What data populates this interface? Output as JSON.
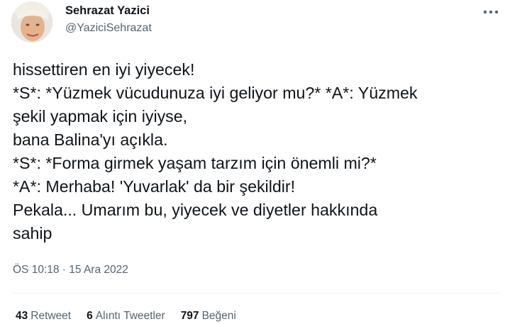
{
  "author": {
    "display_name": "Sehrazat Yazici",
    "handle": "@YaziciSehrazat",
    "avatar_icon": "profile-photo"
  },
  "tweet": {
    "lines": [
      "hissettiren en iyi yiyecek!",
      "*S*: *Yüzmek vücudunuza iyi geliyor mu?* *A*: Yüzmek",
      "şekil yapmak için iyiyse,",
      "bana Balina'yı açıkla.",
      "*S*: *Forma girmek yaşam tarzım için önemli mi?*",
      "*A*: Merhaba! 'Yuvarlak' da bir şekildir!",
      "Pekala... Umarım bu, yiyecek ve diyetler hakkında",
      "sahip"
    ],
    "timestamp": "ÖS 10:18 · 15 Ara 2022"
  },
  "stats": {
    "retweets": {
      "count": "43",
      "label": "Retweet"
    },
    "quotes": {
      "count": "6",
      "label": "Alıntı Tweetler"
    },
    "likes": {
      "count": "797",
      "label": "Beğeni"
    }
  },
  "colors": {
    "text_primary": "#0f1419",
    "text_secondary": "#536471",
    "divider": "#eff3f4"
  }
}
